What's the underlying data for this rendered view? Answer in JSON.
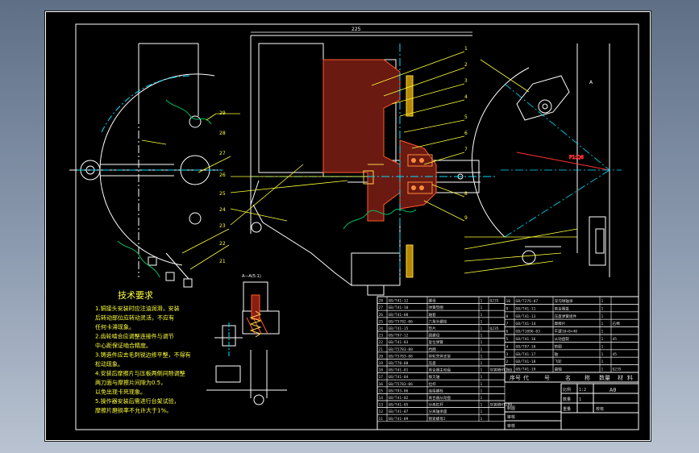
{
  "drawing": {
    "top_dimension": "225",
    "tech_title": "技术要求",
    "tech_lines": [
      "1.铜接头安装时应注油润滑，安装",
      "  后转动部位应转动灵活，不应有",
      "  任何卡滞现象。",
      "2.齿轮啮合应调整连接件与调节",
      "  中心距保证啮合精度。",
      "3.铸造件应去毛刺锐边修平整，不得有",
      "  松动现象。",
      "4.安装后摩擦片与压板两侧间隙调整",
      "  两刀面与摩擦片间隙为0.5，",
      "  以免出现卡死现象。",
      "5.操作器安装后需进行台架试验，",
      "  摩擦片磨损率不允许大于1%。"
    ],
    "section_label": "A—A(5:1)",
    "right_view_label": "P1:Q6",
    "arrow_a": "A"
  },
  "title_block": {
    "header": [
      "序号",
      "代",
      "号",
      "名",
      "称",
      "数量",
      "材",
      "料"
    ],
    "ratio_label": "比例",
    "ratio_value": "1:2",
    "qty_label": "数量",
    "qty_value": "1",
    "weight_label": "重量",
    "paper": "A0",
    "drawn_label": "制图",
    "check_label": "审核",
    "approve_label": "审核",
    "design_label": "校核"
  },
  "parts": [
    {
      "no": "28",
      "code": "GB/T41-12",
      "name": "螺母",
      "qty": "1",
      "mat": "Q235"
    },
    {
      "no": "27",
      "code": "GB/T41-10",
      "name": "弹簧垫圈",
      "qty": "1",
      "mat": ""
    },
    {
      "no": "26",
      "code": "GB/T41-08",
      "name": "轴套",
      "qty": "1",
      "mat": ""
    },
    {
      "no": "25",
      "code": "GB/T5782-06",
      "name": "六角头螺栓",
      "qty": "1",
      "mat": ""
    },
    {
      "no": "24",
      "code": "GB/T41-15",
      "name": "垫片",
      "qty": "1",
      "mat": "Q235"
    },
    {
      "no": "23",
      "code": "GB/T97-12",
      "name": "圆螺母",
      "qty": "1",
      "mat": ""
    },
    {
      "no": "22",
      "code": "GB/T41-03",
      "name": "复位弹簧",
      "qty": "1",
      "mat": ""
    },
    {
      "no": "21",
      "code": "GB/T5783-08",
      "name": "挡圈",
      "qty": "1",
      "mat": ""
    },
    {
      "no": "20",
      "code": "GB/T5783-08",
      "name": "带轮壳体支架",
      "qty": "1",
      "mat": ""
    },
    {
      "no": "19",
      "code": "GB/T78-08",
      "name": "压盘",
      "qty": "1",
      "mat": ""
    },
    {
      "no": "18",
      "code": "GB/T41-01",
      "name": "离合器主动盘",
      "qty": "1",
      "mat": "灰铸铁HT200"
    },
    {
      "no": "17",
      "code": "GB/T41-04",
      "name": "拨叉轴",
      "qty": "1",
      "mat": ""
    },
    {
      "no": "16",
      "code": "GB/T5783-06",
      "name": "拉杆",
      "qty": "1",
      "mat": ""
    },
    {
      "no": "15",
      "code": "GB/T93-06",
      "name": "连接螺栓",
      "qty": "1",
      "mat": ""
    },
    {
      "no": "14",
      "code": "GB/T41-02",
      "name": "离合器从动盘",
      "qty": "1",
      "mat": ""
    },
    {
      "no": "13",
      "code": "GB/T41-05",
      "name": "分离杠杆",
      "qty": "1",
      "mat": "灰铸铁HT200"
    },
    {
      "no": "12",
      "code": "GB/T41-07",
      "name": "分离轴承座",
      "qty": "1",
      "mat": ""
    },
    {
      "no": "11",
      "code": "GB/T41-09",
      "name": "锁紧螺母2",
      "qty": "1",
      "mat": ""
    }
  ],
  "parts_right": [
    {
      "no": "10",
      "code": "GB/T276-07",
      "name": "深沟球轴承",
      "qty": "1",
      "mat": ""
    },
    {
      "no": "9",
      "code": "GB/T41-11",
      "name": "离合器盖",
      "qty": "1",
      "mat": ""
    },
    {
      "no": "8",
      "code": "GB/T41-13",
      "name": "压盘弹簧组件",
      "qty": "1",
      "mat": ""
    },
    {
      "no": "7",
      "code": "GB/T41-14",
      "name": "摩擦片",
      "qty": "1",
      "mat": "石棉"
    },
    {
      "no": "6",
      "code": "GB/T1096-03",
      "name": "平键10×8×40",
      "qty": "1",
      "mat": ""
    },
    {
      "no": "5",
      "code": "GB/T41-16",
      "name": "从动盘毂",
      "qty": "1",
      "mat": "45"
    },
    {
      "no": "4",
      "code": "GB/T97-10",
      "name": "垫圈",
      "qty": "1",
      "mat": ""
    },
    {
      "no": "3",
      "code": "GB/T41-17",
      "name": "轴",
      "qty": "1",
      "mat": "45"
    },
    {
      "no": "2",
      "code": "GB/T41-18",
      "name": "飞轮",
      "qty": "1",
      "mat": ""
    },
    {
      "no": "1",
      "code": "GB/T41-19",
      "name": "曲轴",
      "qty": "1",
      "mat": "Q235"
    }
  ]
}
